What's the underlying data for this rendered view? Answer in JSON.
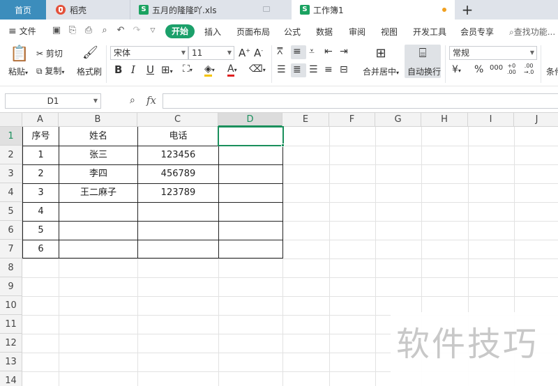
{
  "tabs": {
    "home": "首页",
    "daoke": "稻壳",
    "file1": "五月的隆隆吖.xls",
    "file2": "工作簿1",
    "new_tab": "+"
  },
  "menu": {
    "file": "文件",
    "items": [
      "开始",
      "插入",
      "页面布局",
      "公式",
      "数据",
      "审阅",
      "视图",
      "开发工具",
      "会员专享"
    ],
    "search": "查找功能..."
  },
  "ribbon": {
    "paste": "粘贴",
    "cut": "剪切",
    "copy": "复制",
    "format_painter": "格式刷",
    "font_name": "宋体",
    "font_size": "11",
    "merge_center": "合并居中",
    "wrap_text": "自动换行",
    "number_format": "常规",
    "conditional": "条件"
  },
  "formula_bar": {
    "name_box": "D1",
    "fx": "fx",
    "value": ""
  },
  "sheet": {
    "columns": [
      "A",
      "B",
      "C",
      "D",
      "E",
      "F",
      "G",
      "H",
      "I",
      "J"
    ],
    "selected_column": "D",
    "rows": [
      "1",
      "2",
      "3",
      "4",
      "5",
      "6",
      "7",
      "8",
      "9",
      "10",
      "11",
      "12",
      "13",
      "14"
    ],
    "selected_row": "1",
    "table": [
      [
        "序号",
        "姓名",
        "电话"
      ],
      [
        "1",
        "张三",
        "123456"
      ],
      [
        "2",
        "李四",
        "456789"
      ],
      [
        "3",
        "王二麻子",
        "123789"
      ],
      [
        "4",
        "",
        ""
      ],
      [
        "5",
        "",
        ""
      ],
      [
        "6",
        "",
        ""
      ]
    ]
  },
  "watermark": "软件技巧",
  "colors": {
    "accent": "#1ba06a",
    "home_tab": "#3c8dbc"
  }
}
